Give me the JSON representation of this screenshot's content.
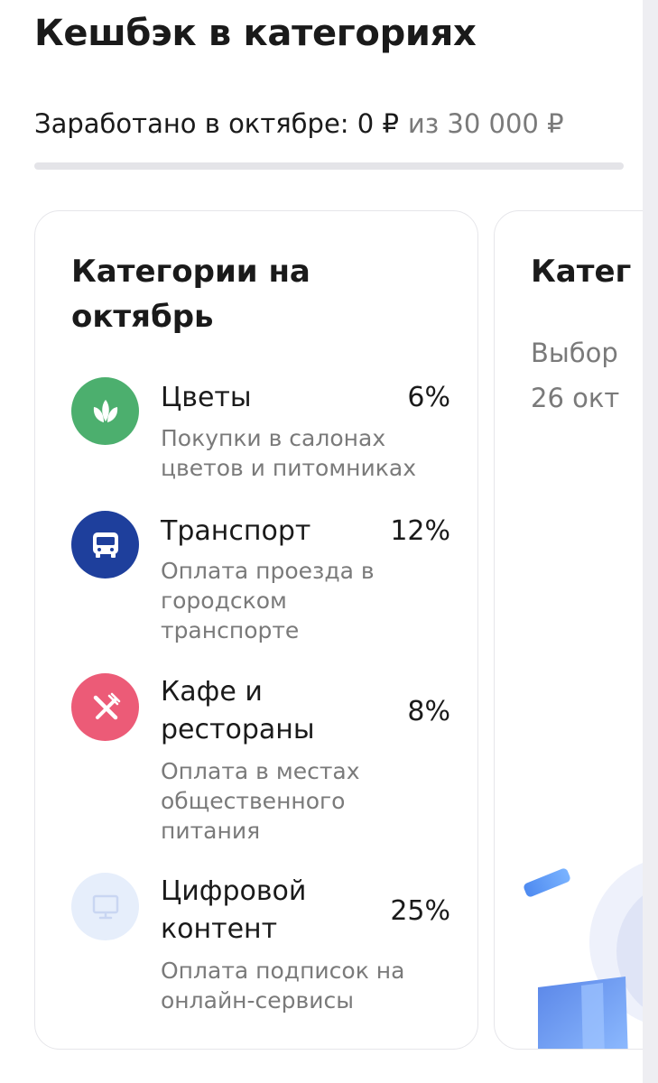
{
  "page": {
    "title": "Кешбэк в категориях",
    "earned_label": "Заработано в октябре: 0 ₽",
    "earned_limit": "из 30 000 ₽",
    "progress_fraction": 0
  },
  "card": {
    "title": "Категории на октябрь",
    "categories": [
      {
        "name": "Цветы",
        "percent": "6%",
        "description": "Покупки в салонах цветов и питомниках",
        "icon": "flower-icon",
        "color": "#4caf6e"
      },
      {
        "name": "Транспорт",
        "percent": "12%",
        "description": "Оплата проезда в городском транспорте",
        "icon": "bus-icon",
        "color": "#1e3f9c"
      },
      {
        "name": "Кафе и рестораны",
        "percent": "8%",
        "description": "Оплата в местах общественного питания",
        "icon": "fork-knife-icon",
        "color": "#ec5b77"
      },
      {
        "name": "Цифровой контент",
        "percent": "25%",
        "description": "Оплата подписок на онлайн-сервисы",
        "icon": "monitor-icon",
        "color": "#e6eefb"
      }
    ]
  },
  "next_card": {
    "title_partial": "Катег",
    "text_line1": "Выбор",
    "text_line2": "26 окт"
  }
}
